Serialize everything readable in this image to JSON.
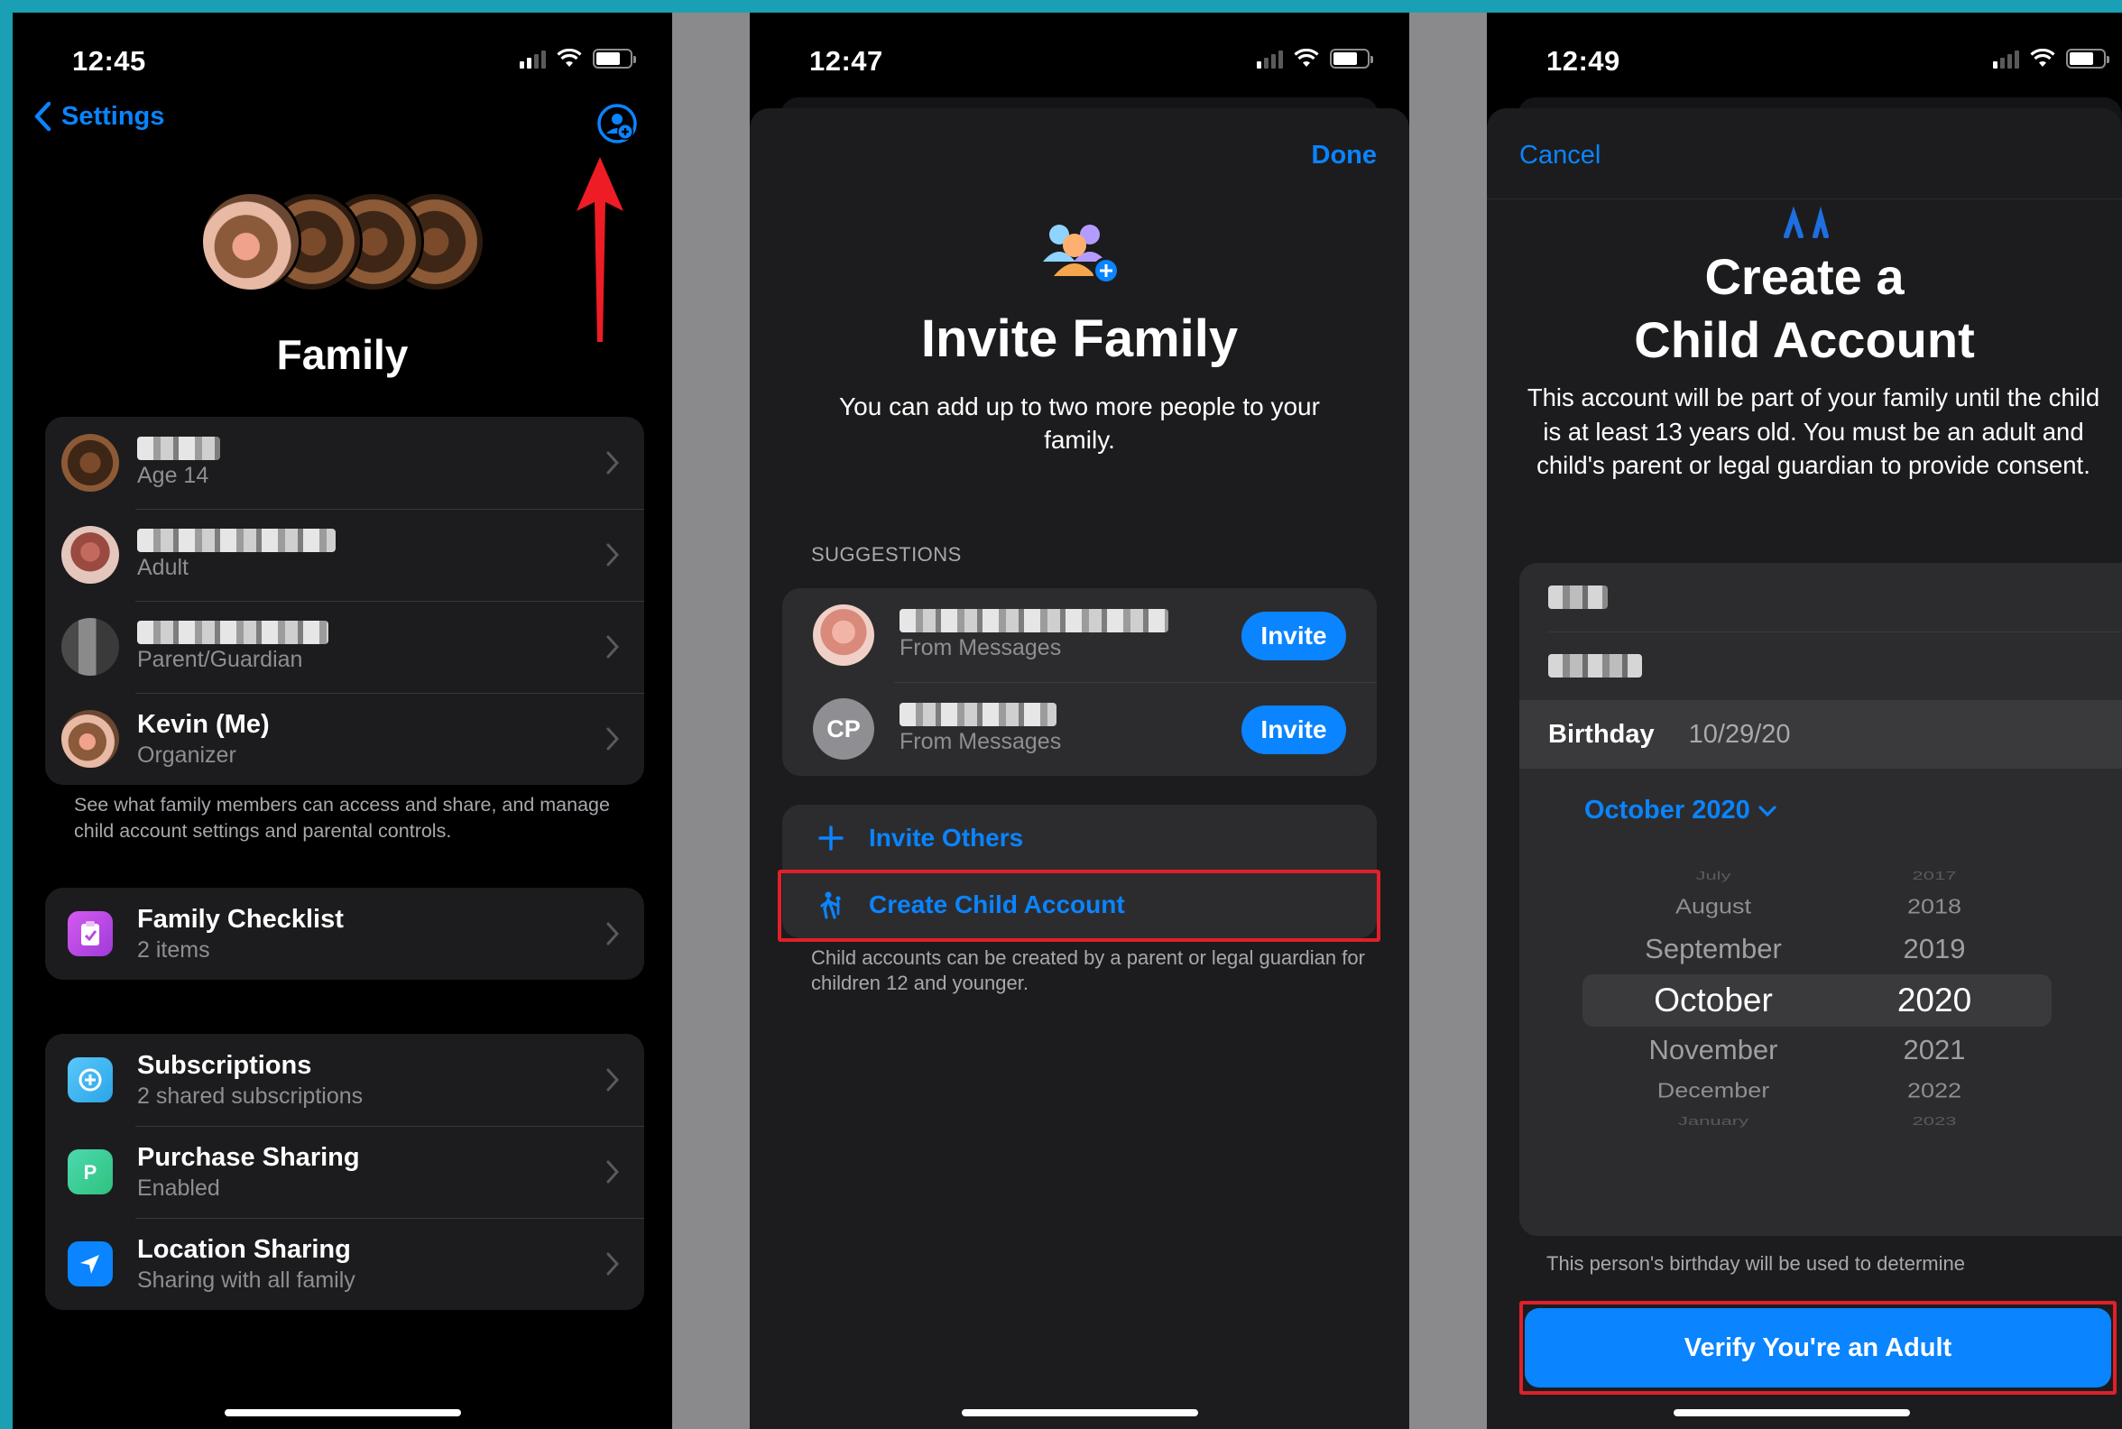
{
  "phone1": {
    "time": "12:45",
    "back_label": "Settings",
    "title": "Family",
    "members": [
      {
        "sub": "Age 14"
      },
      {
        "sub": "Adult"
      },
      {
        "sub": "Parent/Guardian"
      },
      {
        "name": "Kevin (Me)",
        "sub": "Organizer"
      }
    ],
    "members_note": "See what family members can access and share, and manage child account settings and parental controls.",
    "checklist": {
      "title": "Family Checklist",
      "sub": "2 items"
    },
    "subscriptions": {
      "title": "Subscriptions",
      "sub": "2 shared subscriptions"
    },
    "purchase": {
      "title": "Purchase Sharing",
      "sub": "Enabled"
    },
    "location": {
      "title": "Location Sharing",
      "sub": "Sharing with all family"
    }
  },
  "phone2": {
    "time": "12:47",
    "done_label": "Done",
    "title": "Invite Family",
    "description": "You can add up to two more people to your family.",
    "suggestions_label": "SUGGESTIONS",
    "suggestions": [
      {
        "source": "From Messages",
        "button": "Invite"
      },
      {
        "initials": "CP",
        "source": "From Messages",
        "button": "Invite"
      }
    ],
    "invite_others": "Invite Others",
    "create_child": "Create Child Account",
    "child_note": "Child accounts can be created by a parent or legal guardian for children 12 and younger."
  },
  "phone3": {
    "time": "12:49",
    "cancel_label": "Cancel",
    "title_line1": "Create a",
    "title_line2": "Child Account",
    "description": "This account will be part of your family until the child is at least 13 years old. You must be an adult and child's parent or legal guardian to provide consent.",
    "birthday_label": "Birthday",
    "birthday_value": "10/29/20",
    "month_year": "October 2020",
    "picker_months": [
      "July",
      "August",
      "September",
      "October",
      "November",
      "December",
      "January"
    ],
    "picker_years": [
      "2017",
      "2018",
      "2019",
      "2020",
      "2021",
      "2022",
      "2023"
    ],
    "birthday_note": "This person's birthday will be used to determine",
    "verify_button": "Verify You're an Adult"
  },
  "colors": {
    "accent": "#0a84ff",
    "highlight_red": "#e0202a",
    "background_teal": "#1a9fb5"
  }
}
